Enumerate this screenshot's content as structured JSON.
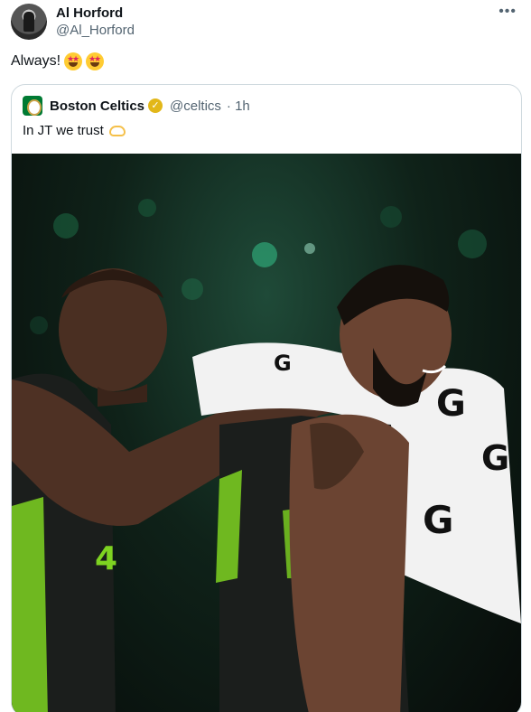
{
  "tweet": {
    "author_name": "Al Horford",
    "author_handle": "@Al_Horford",
    "more_icon": "•••",
    "text": "Always!",
    "emojis": [
      "star-struck",
      "star-struck"
    ]
  },
  "quoted_tweet": {
    "author_name": "Boston Celtics",
    "author_handle": "@celtics",
    "time": "· 1h",
    "text": "In JT we trust",
    "emoji": "heart-hands",
    "verified_badge": "gold-check",
    "photo": {
      "alt_description": "Al Horford with arm around Jayson Tatum, Gatorade towel on shoulder",
      "towel_brand_mark": "G"
    }
  },
  "colors": {
    "text": "#0f1419",
    "secondary_text": "#536471",
    "border": "#cfd9de",
    "celtics_green": "#007a33",
    "verified_gold": "#e2b719"
  }
}
